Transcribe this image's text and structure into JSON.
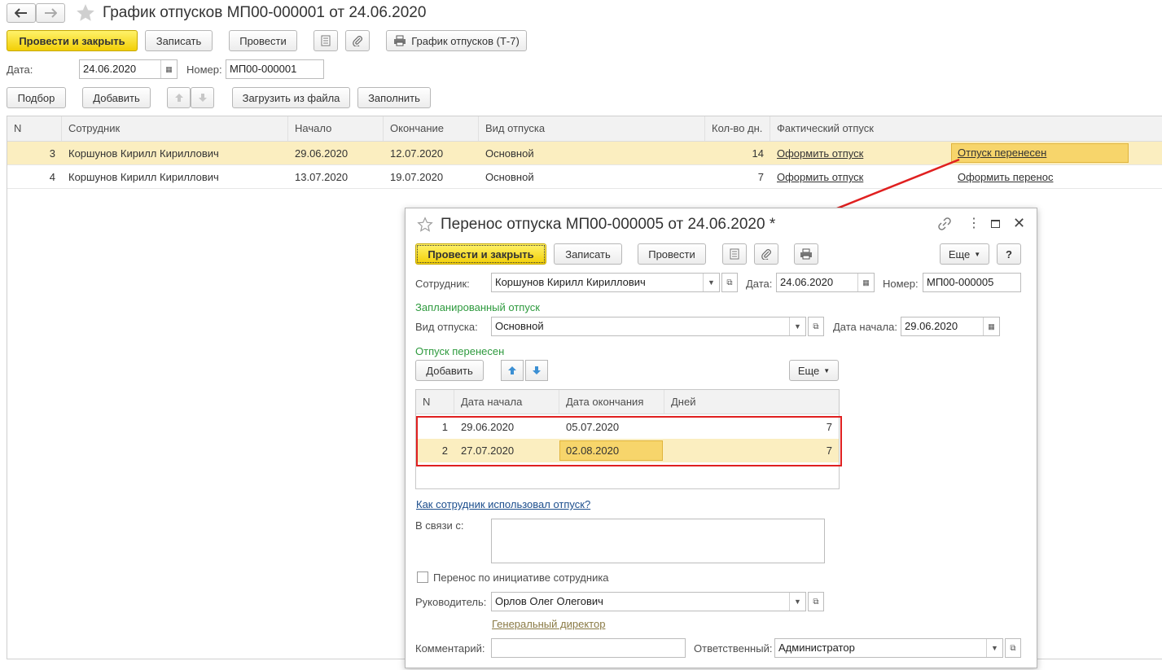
{
  "main": {
    "title": "График отпусков МП00-000001 от 24.06.2020",
    "toolbar": {
      "post_close": "Провести и закрыть",
      "save": "Записать",
      "post": "Провести",
      "print_schedule": "График отпусков (Т-7)"
    },
    "date_label": "Дата:",
    "date_value": "24.06.2020",
    "number_label": "Номер:",
    "number_value": "МП00-000001",
    "table_toolbar": {
      "pick": "Подбор",
      "add": "Добавить",
      "load": "Загрузить из файла",
      "fill": "Заполнить"
    },
    "columns": [
      "N",
      "Сотрудник",
      "Начало",
      "Окончание",
      "Вид отпуска",
      "Кол-во дн.",
      "Фактический отпуск"
    ],
    "rows": [
      {
        "n": "3",
        "employee": "Коршунов Кирилл Кириллович",
        "start": "29.06.2020",
        "end": "12.07.2020",
        "type": "Основной",
        "days": "14",
        "action1": "Оформить отпуск",
        "action2": "Отпуск перенесен"
      },
      {
        "n": "4",
        "employee": "Коршунов Кирилл Кириллович",
        "start": "13.07.2020",
        "end": "19.07.2020",
        "type": "Основной",
        "days": "7",
        "action1": "Оформить отпуск",
        "action2": "Оформить перенос"
      }
    ]
  },
  "dialog": {
    "title": "Перенос отпуска МП00-000005 от 24.06.2020 *",
    "toolbar": {
      "post_close": "Провести и закрыть",
      "save": "Записать",
      "post": "Провести",
      "more": "Еще",
      "help": "?"
    },
    "employee_label": "Сотрудник:",
    "employee_value": "Коршунов Кирилл Кириллович",
    "date_label": "Дата:",
    "date_value": "24.06.2020",
    "number_label": "Номер:",
    "number_value": "МП00-000005",
    "planned_header": "Запланированный отпуск",
    "vacation_type_label": "Вид отпуска:",
    "vacation_type_value": "Основной",
    "start_date_label": "Дата начала:",
    "start_date_value": "29.06.2020",
    "moved_header": "Отпуск перенесен",
    "add_button": "Добавить",
    "more_button": "Еще",
    "columns": [
      "N",
      "Дата начала",
      "Дата окончания",
      "Дней"
    ],
    "rows": [
      {
        "n": "1",
        "start": "29.06.2020",
        "end": "05.07.2020",
        "days": "7"
      },
      {
        "n": "2",
        "start": "27.07.2020",
        "end": "02.08.2020",
        "days": "7"
      }
    ],
    "usage_link": "Как сотрудник использовал отпуск?",
    "reason_label": "В связи с:",
    "reason_value": "",
    "initiative_label": "Перенос по инициативе сотрудника",
    "initiative_checked": false,
    "manager_label": "Руководитель:",
    "manager_value": "Орлов Олег Олегович",
    "manager_position": "Генеральный директор",
    "comment_label": "Комментарий:",
    "comment_value": "",
    "responsible_label": "Ответственный:",
    "responsible_value": "Администратор"
  },
  "colors": {
    "primary_button": "#f5d30f",
    "selected_row": "#fbeec0",
    "selected_cell": "#f7d56b",
    "annotation_red": "#e02020",
    "section_green": "#2e9a3e"
  }
}
